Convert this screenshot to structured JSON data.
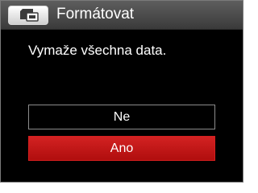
{
  "header": {
    "title": "Formátovat",
    "mode_icon": "memory-card-format-icon"
  },
  "dialog": {
    "message": "Vymaže všechna data.",
    "options": [
      {
        "label": "Ne",
        "selected": false
      },
      {
        "label": "Ano",
        "selected": true
      }
    ]
  },
  "colors": {
    "background": "#000000",
    "header": "#4a4a4a",
    "selected": "#c81818",
    "text": "#ffffff",
    "border": "#8c8c8c"
  }
}
